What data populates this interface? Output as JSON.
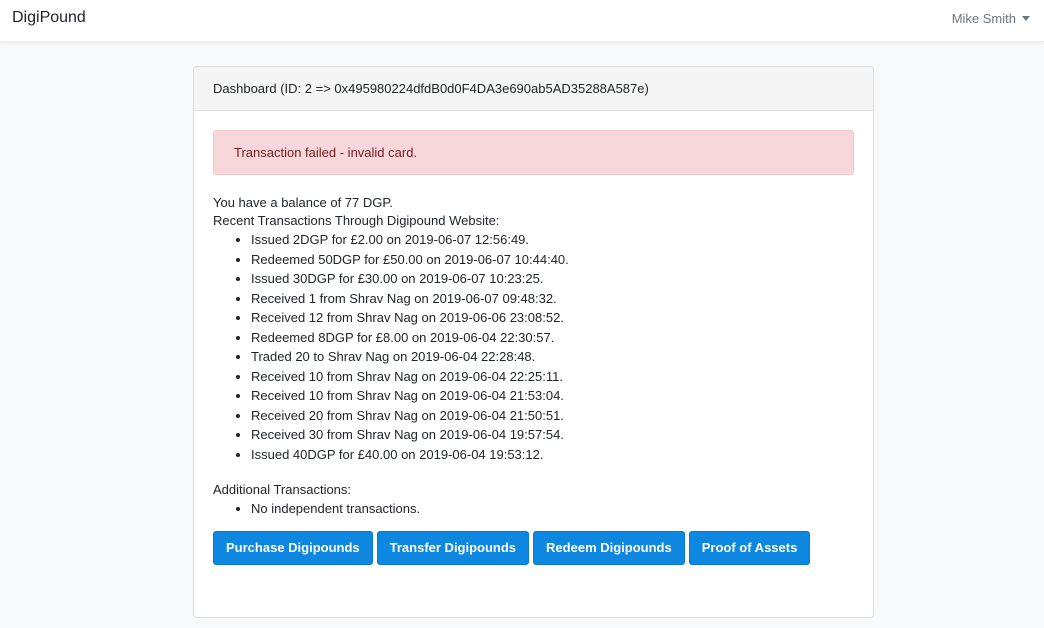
{
  "navbar": {
    "brand": "DigiPound",
    "user_name": "Mike Smith"
  },
  "dashboard": {
    "header": "Dashboard (ID: 2 => 0x495980224dfdB0d0F4DA3e690ab5AD35288A587e)",
    "alert": "Transaction failed - invalid card.",
    "balance_text": "You have a balance of 77 DGP.",
    "recent_title": "Recent Transactions Through Digipound Website:",
    "recent_transactions": [
      "Issued 2DGP for £2.00 on 2019-06-07 12:56:49.",
      "Redeemed 50DGP for £50.00 on 2019-06-07 10:44:40.",
      "Issued 30DGP for £30.00 on 2019-06-07 10:23:25.",
      "Received 1 from Shrav Nag on 2019-06-07 09:48:32.",
      "Received 12 from Shrav Nag on 2019-06-06 23:08:52.",
      "Redeemed 8DGP for £8.00 on 2019-06-04 22:30:57.",
      "Traded 20 to Shrav Nag on 2019-06-04 22:28:48.",
      "Received 10 from Shrav Nag on 2019-06-04 22:25:11.",
      "Received 10 from Shrav Nag on 2019-06-04 21:53:04.",
      "Received 20 from Shrav Nag on 2019-06-04 21:50:51.",
      "Received 30 from Shrav Nag on 2019-06-04 19:57:54.",
      "Issued 40DGP for £40.00 on 2019-06-04 19:53:12."
    ],
    "additional_title": "Additional Transactions:",
    "additional_transactions": [
      "No independent transactions."
    ],
    "buttons": {
      "purchase": "Purchase Digipounds",
      "transfer": "Transfer Digipounds",
      "redeem": "Redeem Digipounds",
      "proof": "Proof of Assets"
    }
  },
  "colors": {
    "primary_button": "#0d87e0",
    "alert_background": "#f8d7da",
    "alert_text": "#721c24"
  }
}
